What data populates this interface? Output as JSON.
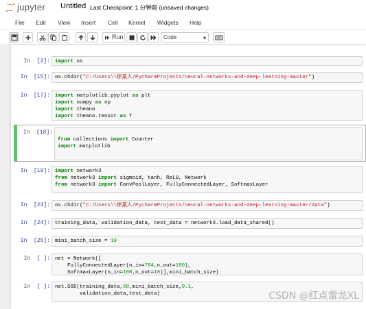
{
  "header": {
    "logo_text": "jupyter",
    "notebook_title": "Untitled",
    "checkpoint": "Last Checkpoint: 1 分钟前   (unsaved changes)"
  },
  "menubar": {
    "items": [
      "File",
      "Edit",
      "View",
      "Insert",
      "Cell",
      "Kernel",
      "Widgets",
      "Help"
    ]
  },
  "toolbar": {
    "run_label": "Run",
    "cell_type": "Code",
    "icons": [
      "save-icon",
      "plus-icon",
      "cut-icon",
      "copy-icon",
      "paste-icon",
      "arrow-up-icon",
      "arrow-down-icon",
      "run-icon",
      "stop-icon",
      "restart-icon",
      "fast-forward-icon",
      "keyboard-icon"
    ]
  },
  "cells": [
    {
      "prompt": "In  [2]:",
      "lines": [
        [
          [
            "kw",
            "import"
          ],
          [
            "t",
            " os"
          ]
        ]
      ]
    },
    {
      "prompt": "In  [15]:",
      "lines": [
        [
          [
            "t",
            "os.chdir("
          ],
          [
            "str",
            "\"C:/Users\\\\徐某人/PycharmProjects/neural-networks-and-deep-learning-master\""
          ],
          [
            "t",
            ")"
          ]
        ]
      ]
    },
    {
      "prompt": "In  [17]:",
      "lines": [
        [
          [
            "kw",
            "import"
          ],
          [
            "t",
            " matplotlib.pyplot "
          ],
          [
            "kw",
            "as"
          ],
          [
            "t",
            " plt"
          ]
        ],
        [
          [
            "kw",
            "import"
          ],
          [
            "t",
            " numpy "
          ],
          [
            "kw",
            "as"
          ],
          [
            "t",
            " np"
          ]
        ],
        [
          [
            "kw",
            "import"
          ],
          [
            "t",
            " theano"
          ]
        ],
        [
          [
            "kw",
            "import"
          ],
          [
            "t",
            " theano.tensor "
          ],
          [
            "kw",
            "as"
          ],
          [
            "t",
            " T"
          ]
        ]
      ]
    },
    {
      "prompt": "In  [18]:",
      "selected": true,
      "lines": [
        [
          [
            "t",
            ""
          ]
        ],
        [
          [
            "kw",
            "from"
          ],
          [
            "t",
            " collections "
          ],
          [
            "kw",
            "import"
          ],
          [
            "t",
            " Counter"
          ]
        ],
        [
          [
            "kw",
            "import"
          ],
          [
            "t",
            " matplotlib"
          ]
        ],
        [
          [
            "t",
            ""
          ]
        ]
      ]
    },
    {
      "prompt": "In  [19]:",
      "lines": [
        [
          [
            "kw",
            "import"
          ],
          [
            "t",
            " network3"
          ]
        ],
        [
          [
            "kw",
            "from"
          ],
          [
            "t",
            " network3 "
          ],
          [
            "kw",
            "import"
          ],
          [
            "t",
            " sigmoid, tanh, ReLU, Network"
          ]
        ],
        [
          [
            "kw",
            "from"
          ],
          [
            "t",
            " network3 "
          ],
          [
            "kw",
            "import"
          ],
          [
            "t",
            " ConvPoolLayer, FullyConnectedLayer, SoftmaxLayer"
          ]
        ]
      ]
    },
    {
      "prompt": "In  [23]:",
      "lines": [
        [
          [
            "t",
            "os.chdir("
          ],
          [
            "str",
            "\"C:/Users\\\\徐某人/PycharmProjects/neural-networks-and-deep-learning-master/data\""
          ],
          [
            "t",
            ")"
          ]
        ]
      ]
    },
    {
      "prompt": "In  [24]:",
      "lines": [
        [
          [
            "t",
            "training_data, validation_data, test_data = network3.load_data_shared()"
          ]
        ]
      ]
    },
    {
      "prompt": "In  [25]:",
      "lines": [
        [
          [
            "t",
            "mini_batch_size = "
          ],
          [
            "num",
            "10"
          ]
        ]
      ]
    },
    {
      "prompt": "In  [ ]:",
      "lines": [
        [
          [
            "t",
            "net = Network(["
          ]
        ],
        [
          [
            "t",
            "    FullyConnectedLayer(n_in="
          ],
          [
            "num",
            "784"
          ],
          [
            "t",
            ",n_out="
          ],
          [
            "num",
            "100"
          ],
          [
            "t",
            "),"
          ]
        ],
        [
          [
            "t",
            "    SoftmaxLayer(n_in="
          ],
          [
            "num",
            "100"
          ],
          [
            "t",
            ",n_out="
          ],
          [
            "num",
            "10"
          ],
          [
            "t",
            ")],mini_batch_size)"
          ]
        ]
      ]
    },
    {
      "prompt": "In  [ ]:",
      "lines": [
        [
          [
            "t",
            "net.SGD(training_data,"
          ],
          [
            "num",
            "60"
          ],
          [
            "t",
            ",mini_batch_size,"
          ],
          [
            "num",
            "0.1"
          ],
          [
            "t",
            ","
          ]
        ],
        [
          [
            "t",
            "        validation_data,test_data)"
          ]
        ]
      ]
    }
  ],
  "watermark": "CSDN @红点雷龙XL",
  "colors": {
    "prompt": "#303f9f",
    "keyword": "#008000",
    "string": "#ba2121",
    "selected_border": "#66bb6a",
    "logo_orange": "#f37726"
  }
}
